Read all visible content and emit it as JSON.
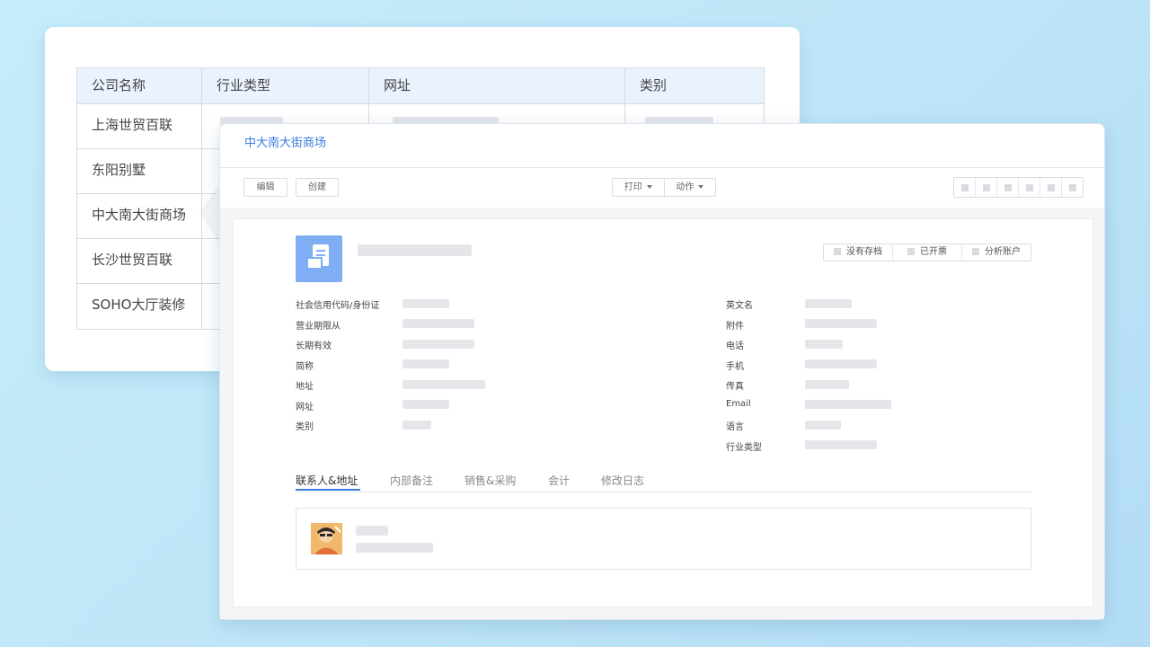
{
  "company_table": {
    "headers": [
      "公司名称",
      "行业类型",
      "网址",
      "类别"
    ],
    "rows": [
      "上海世贸百联",
      "东阳别墅",
      "中大南大街商场",
      "长沙世贸百联",
      "SOHO大厅装修"
    ]
  },
  "detail": {
    "title": "中大南大街商场",
    "toolbar": {
      "edit": "编辑",
      "create": "创建",
      "print": "打印",
      "action": "动作"
    },
    "status_buttons": [
      "没有存档",
      "已开票",
      "分析账户"
    ],
    "left_fields": [
      "社会信用代码/身份证",
      "营业期限从",
      "长期有效",
      "简称",
      "地址",
      "网址",
      "类别"
    ],
    "right_fields": [
      "英文名",
      "附件",
      "电话",
      "手机",
      "传真",
      "Email",
      "语言",
      "行业类型"
    ],
    "tabs": [
      "联系人&地址",
      "内部备注",
      "销售&采购",
      "会计",
      "修改日志"
    ],
    "active_tab": "联系人&地址"
  },
  "colors": {
    "accent": "#3a7be0",
    "header_bg": "#eaf2fe",
    "avatar_bg": "#7faef5",
    "placeholder": "#e4e6ea"
  }
}
